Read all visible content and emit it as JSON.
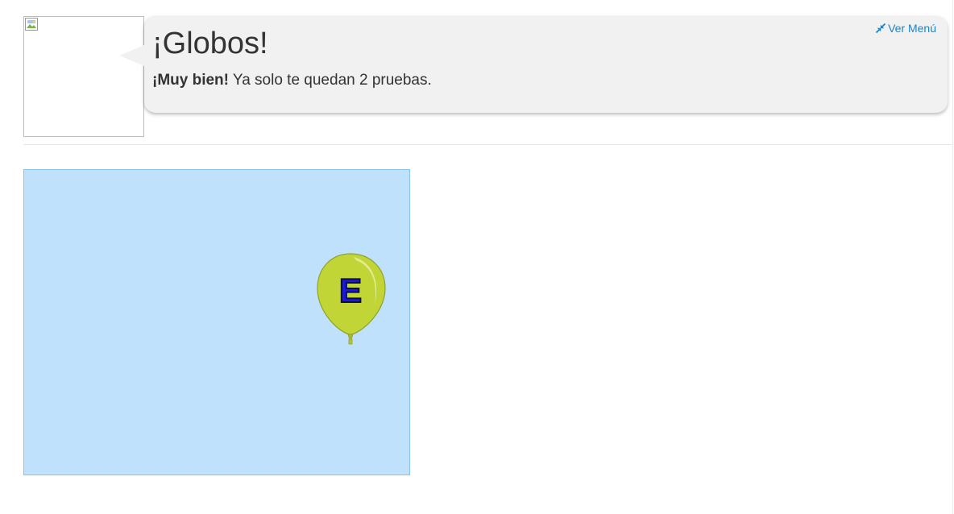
{
  "header": {
    "title": "¡Globos!",
    "message_bold": "¡Muy bien!",
    "message_rest": " Ya solo te quedan 2 pruebas.",
    "menu_link": "Ver Menú"
  },
  "icons": {
    "avatar": "broken-image-icon",
    "menu": "collapse-arrows-icon"
  },
  "game": {
    "balloon_letter": "E",
    "balloon_color": "#c2d537",
    "background_color": "#c0e1fb",
    "letter_color": "#1a1adf"
  }
}
